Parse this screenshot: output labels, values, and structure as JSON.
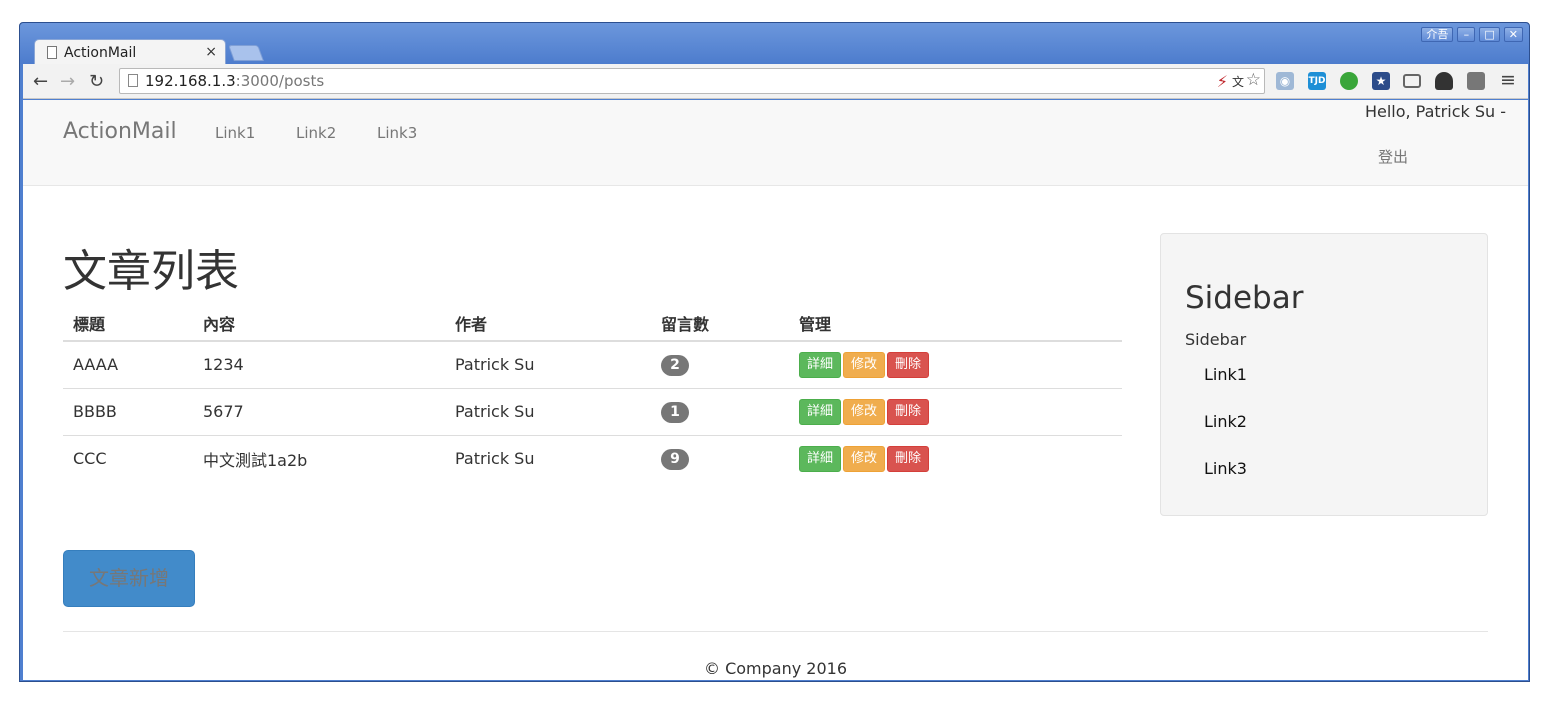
{
  "browser": {
    "tab_title": "ActionMail",
    "tab_close": "×",
    "url_host": "192.168.1.3",
    "url_rest": ":3000/posts",
    "window_buttons": [
      "介吾",
      "–",
      "□",
      "✕"
    ],
    "ime_label": "介吾"
  },
  "navbar": {
    "brand": "ActionMail",
    "links": [
      "Link1",
      "Link2",
      "Link3"
    ],
    "greeting": "Hello, Patrick Su -",
    "logout": "登出"
  },
  "main": {
    "title": "文章列表",
    "columns": [
      "標題",
      "內容",
      "作者",
      "留言數",
      "管理"
    ],
    "rows": [
      {
        "title": "AAAA",
        "content": "1234",
        "author": "Patrick Su",
        "comments": "2"
      },
      {
        "title": "BBBB",
        "content": "5677",
        "author": "Patrick Su",
        "comments": "1"
      },
      {
        "title": "CCC",
        "content": "中文測試1a2b",
        "author": "Patrick Su",
        "comments": "9"
      }
    ],
    "actions": {
      "detail": "詳細",
      "edit": "修改",
      "delete": "刪除"
    },
    "new_post": "文章新增"
  },
  "sidebar": {
    "title": "Sidebar",
    "subtitle": "Sidebar",
    "links": [
      "Link1",
      "Link2",
      "Link3"
    ]
  },
  "footer": {
    "text": "© Company 2016"
  },
  "colors": {
    "success": "#5cb85c",
    "warning": "#f0ad4e",
    "danger": "#d9534f",
    "primary": "#428bca",
    "badge": "#777777"
  }
}
